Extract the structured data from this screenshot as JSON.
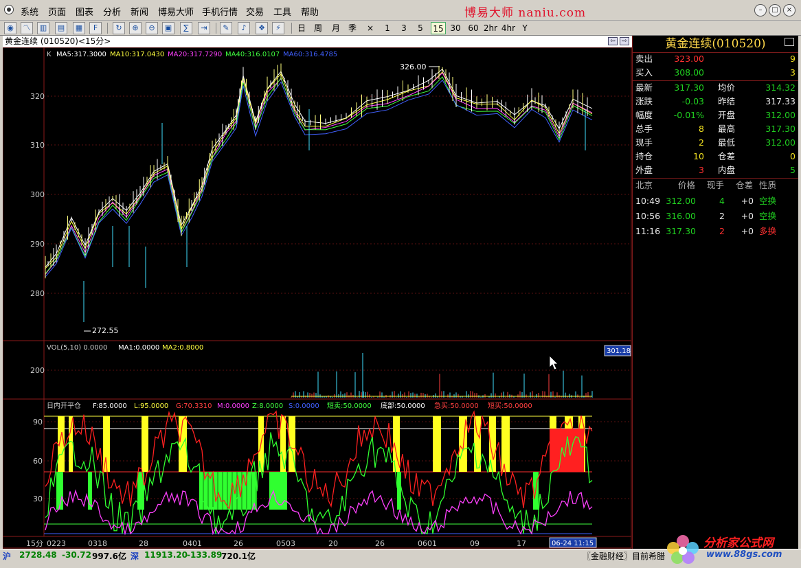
{
  "menu": {
    "items": [
      "系统",
      "页面",
      "图表",
      "分析",
      "新闻",
      "博易大师",
      "手机行情",
      "交易",
      "工具",
      "帮助"
    ],
    "brand": "博易大师 naniu.com"
  },
  "toolbar": {
    "periods": [
      "日",
      "周",
      "月",
      "季",
      "×",
      "1",
      "3",
      "5",
      "15",
      "30",
      "60",
      "2hr",
      "4hr",
      "Y"
    ],
    "active_period": "15"
  },
  "chart": {
    "title": "黄金连续 (010520)<15分>",
    "ma_legend": {
      "k": "K",
      "ma5": "MA5:317.3000",
      "ma10": "MA10:317.0430",
      "ma20": "MA20:317.7290",
      "ma40": "MA40:316.0107",
      "ma60": "MA60:316.4785"
    },
    "y_ticks": [
      "320",
      "310",
      "300",
      "290",
      "280"
    ],
    "high_marker": "326.00",
    "low_marker": "272.55",
    "vol_legend": {
      "vol": "VOL(5,10) 0.0000",
      "ma1": "MA1:0.0000",
      "ma2": "MA2:0.8000"
    },
    "vol_tick": "200",
    "vol_badge": "301.18",
    "ind_legend": {
      "name": "日内开平仓",
      "f": "F:85.0000",
      "l": "L:95.0000",
      "g": "G:70.3310",
      "m": "M:0.0000",
      "z": "Z:8.0000",
      "s": "S:0.0000",
      "dm": "短卖:50.0000",
      "db": "底部:50.0000",
      "jm": "急买:50.0000",
      "dbuy": "短买:50.0000"
    },
    "ind_ticks": [
      "90",
      "60",
      "30"
    ],
    "x_period": "15分",
    "x_labels": [
      "0223",
      "0318",
      "28",
      "0401",
      "26",
      "0503",
      "20",
      "26",
      "0601",
      "09",
      "17"
    ],
    "x_cursor": "06-24 11:15"
  },
  "quote": {
    "name": "黄金连续(010520)",
    "sell_label": "卖出",
    "sell_price": "323.00",
    "sell_qty": "9",
    "buy_label": "买入",
    "buy_price": "308.00",
    "buy_qty": "3",
    "rows": [
      {
        "l1": "最新",
        "v1": "317.30",
        "c1": "#20d020",
        "l2": "均价",
        "v2": "314.32",
        "c2": "#20d020"
      },
      {
        "l1": "涨跌",
        "v1": "-0.03",
        "c1": "#20d020",
        "l2": "昨结",
        "v2": "317.33",
        "c2": "#e8e8e8"
      },
      {
        "l1": "幅度",
        "v1": "-0.01%",
        "c1": "#20d020",
        "l2": "开盘",
        "v2": "312.00",
        "c2": "#20d020"
      },
      {
        "l1": "总手",
        "v1": "8",
        "c1": "#f0e020",
        "l2": "最高",
        "v2": "317.30",
        "c2": "#20d020"
      },
      {
        "l1": "现手",
        "v1": "2",
        "c1": "#f0e020",
        "l2": "最低",
        "v2": "312.00",
        "c2": "#20d020"
      },
      {
        "l1": "持仓",
        "v1": "10",
        "c1": "#f0e020",
        "l2": "仓差",
        "v2": "0",
        "c2": "#f0e020"
      },
      {
        "l1": "外盘",
        "v1": "3",
        "c1": "#ff3030",
        "l2": "内盘",
        "v2": "5",
        "c2": "#20d020"
      }
    ],
    "ticks_header": [
      "北京",
      "价格",
      "现手",
      "仓差",
      "性质"
    ],
    "ticks": [
      {
        "time": "10:49",
        "price": "312.00",
        "qty": "4",
        "qty_color": "#20d020",
        "diff": "+0",
        "type": "空换",
        "type_color": "#20d020"
      },
      {
        "time": "10:56",
        "price": "316.00",
        "qty": "2",
        "qty_color": "#e8e8e8",
        "diff": "+0",
        "type": "空换",
        "type_color": "#20d020"
      },
      {
        "time": "11:16",
        "price": "317.30",
        "qty": "2",
        "qty_color": "#ff3030",
        "diff": "+0",
        "type": "多换",
        "type_color": "#ff3030"
      }
    ]
  },
  "status": {
    "sh_label": "沪",
    "sh_index": "2728.48",
    "sh_change": "-30.72",
    "sh_amount": "997.6亿",
    "sz_label": "深",
    "sz_index": "11913.20",
    "sz_change": "-133.89",
    "sz_amount": "720.1亿",
    "news": "〖金融财经〗目前希腊"
  },
  "watermark": {
    "name": "分析家公式网",
    "url": "www.88gs.com"
  }
}
